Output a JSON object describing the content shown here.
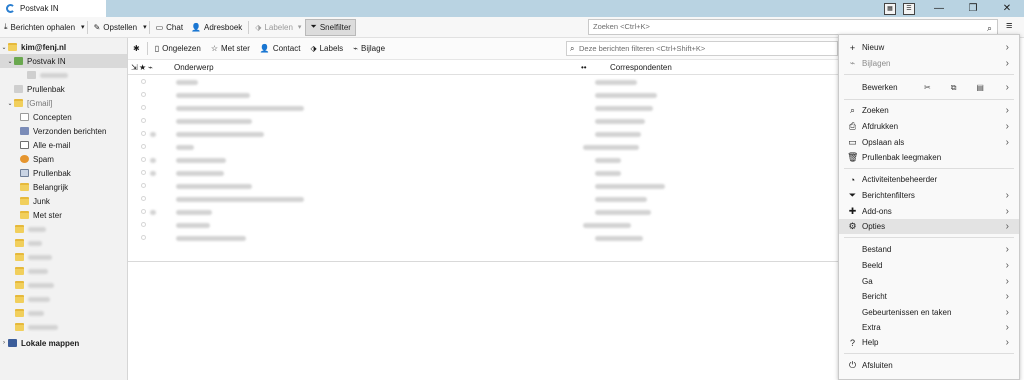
{
  "window": {
    "tab_title": "Postvak IN",
    "search_placeholder": "Zoeken <Ctrl+K>"
  },
  "toolbar": {
    "get_messages": "Berichten ophalen",
    "compose": "Opstellen",
    "chat": "Chat",
    "address_book": "Adresboek",
    "labels": "Labelen",
    "quick_filter": "Snelfilter"
  },
  "folders": {
    "account": "kim@fenj.nl",
    "inbox": "Postvak IN",
    "trash_top": "Prullenbak",
    "gmail": "[Gmail]",
    "gmail_children": [
      "Concepten",
      "Verzonden berichten",
      "Alle e-mail",
      "Spam",
      "Prullenbak",
      "Belangrijk",
      "Junk",
      "Met ster"
    ],
    "local_folders": "Lokale mappen"
  },
  "messagebar": {
    "unread": "Ongelezen",
    "starred": "Met ster",
    "contact": "Contact",
    "labels": "Labels",
    "attachment": "Bijlage",
    "filter_placeholder": "Deze berichten filteren <Ctrl+Shift+K>"
  },
  "columns": {
    "subject": "Onderwerp",
    "correspondents": "Correspondenten"
  },
  "menu": {
    "new": "Nieuw",
    "attachments": "Bijlagen",
    "edit": "Bewerken",
    "find": "Zoeken",
    "print": "Afdrukken",
    "save_as": "Opslaan als",
    "empty_trash": "Prullenbak leegmaken",
    "activity": "Activiteitenbeheerder",
    "filters": "Berichtenfilters",
    "addons": "Add-ons",
    "options": "Opties",
    "file": "Bestand",
    "view": "Beeld",
    "go": "Ga",
    "message": "Bericht",
    "events": "Gebeurtenissen en taken",
    "extra": "Extra",
    "help": "Help",
    "quit": "Afsluiten"
  }
}
